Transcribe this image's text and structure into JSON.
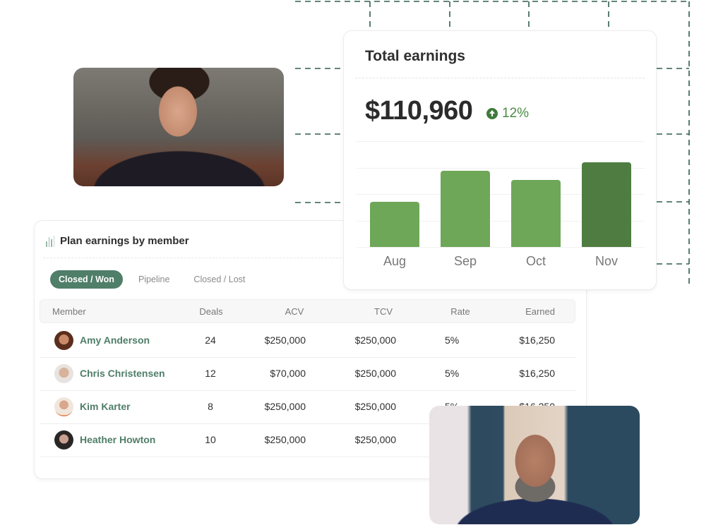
{
  "earnings_card": {
    "title": "Total earnings",
    "amount": "$110,960",
    "change": "12%",
    "change_icon": "arrow-up-circle-icon",
    "accent_color": "#4b8a44"
  },
  "chart_data": {
    "type": "bar",
    "title": "Total earnings",
    "categories": [
      "Aug",
      "Sep",
      "Oct",
      "Nov"
    ],
    "values": [
      57,
      96,
      84,
      106
    ],
    "ylim": [
      0,
      133
    ],
    "grid": true,
    "xlabel": "",
    "ylabel": "",
    "colors": [
      "#6ea758",
      "#6ea758",
      "#6ea758",
      "#4f7d41"
    ],
    "note": "y-axis unlabeled; values are relative bar heights"
  },
  "plan_card": {
    "title": "Plan earnings by member",
    "icon": "bar-chart-icon",
    "tabs": [
      {
        "label": "Closed / Won",
        "active": true
      },
      {
        "label": "Pipeline",
        "active": false
      },
      {
        "label": "Closed / Lost",
        "active": false
      }
    ],
    "columns": [
      "Member",
      "Deals",
      "ACV",
      "TCV",
      "Rate",
      "Earned"
    ],
    "rows": [
      {
        "name": "Amy Anderson",
        "deals": "24",
        "acv": "$250,000",
        "tcv": "$250,000",
        "rate": "5%",
        "earned": "$16,250"
      },
      {
        "name": "Chris Christensen",
        "deals": "12",
        "acv": "$70,000",
        "tcv": "$250,000",
        "rate": "5%",
        "earned": "$16,250"
      },
      {
        "name": "Kim Karter",
        "deals": "8",
        "acv": "$250,000",
        "tcv": "$250,000",
        "rate": "5%",
        "earned": "$16,250"
      },
      {
        "name": "Heather Howton",
        "deals": "10",
        "acv": "$250,000",
        "tcv": "$250,000",
        "rate": "",
        "earned": ""
      }
    ],
    "accent_color": "#4f7e69"
  },
  "photos": [
    {
      "label": "video-participant-1"
    },
    {
      "label": "video-participant-2"
    }
  ]
}
